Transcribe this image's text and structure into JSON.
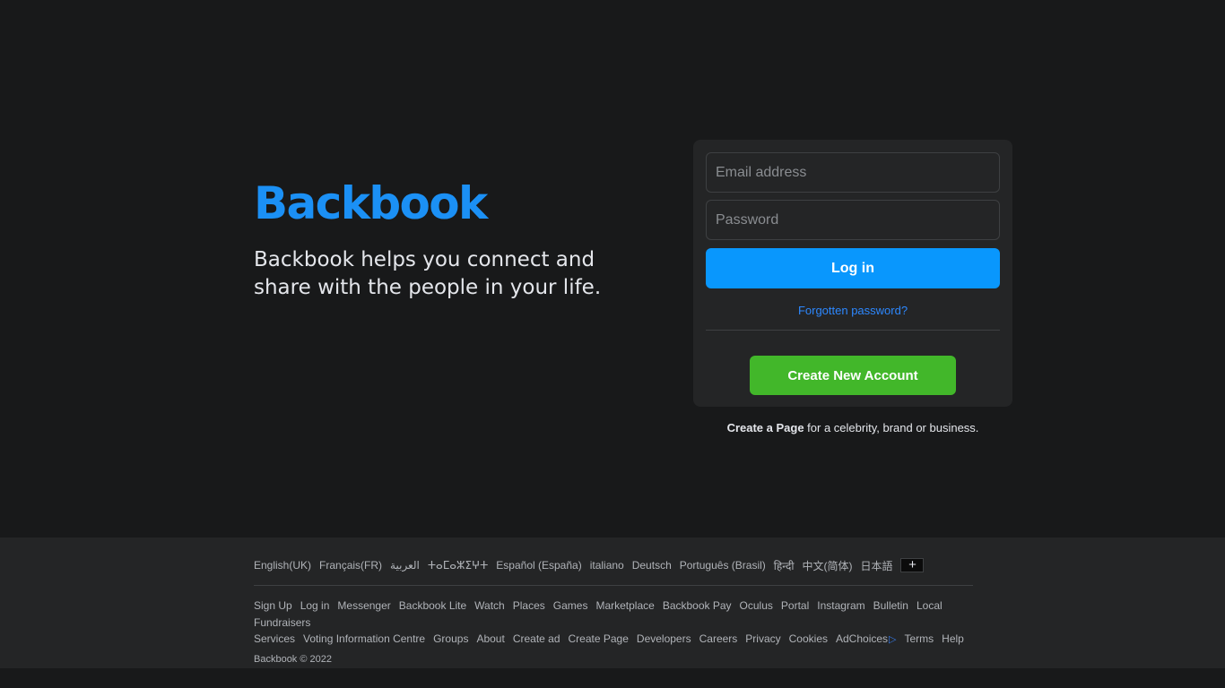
{
  "brand": {
    "name": "Backbook",
    "tagline": "Backbook helps you connect and share with the people in your life."
  },
  "login": {
    "email_placeholder": "Email address",
    "password_placeholder": "Password",
    "login_label": "Log in",
    "forgot_label": "Forgotten password?",
    "create_label": "Create New Account"
  },
  "create_page": {
    "link": "Create a Page",
    "rest": " for a celebrity, brand or business."
  },
  "footer": {
    "languages": [
      "English(UK)",
      "Français(FR)",
      "العربية",
      "ⵜⴰⵎⴰⵣⵉⵖⵜ",
      "Español (España)",
      "italiano",
      "Deutsch",
      "Português (Brasil)",
      "हिन्दी",
      "中文(简体)",
      "日本語"
    ],
    "more_languages_symbol": "+",
    "links": [
      "Sign Up",
      "Log in",
      "Messenger",
      "Backbook Lite",
      "Watch",
      "Places",
      "Games",
      "Marketplace",
      "Backbook Pay",
      "Oculus",
      "Portal",
      "Instagram",
      "Bulletin",
      "Local",
      "Fundraisers",
      "Services",
      "Voting Information Centre",
      "Groups",
      "About",
      "Create ad",
      "Create Page",
      "Developers",
      "Careers",
      "Privacy",
      "Cookies",
      "AdChoices",
      "Terms",
      "Help"
    ],
    "adchoices_icon": "adchoices-icon",
    "copyright": "Backbook © 2022"
  },
  "colors": {
    "background": "#18191a",
    "card": "#242526",
    "brand_blue": "#1b90f5",
    "login_button": "#0997fd",
    "create_button": "#42b72a",
    "link_blue": "#2d88ff"
  }
}
